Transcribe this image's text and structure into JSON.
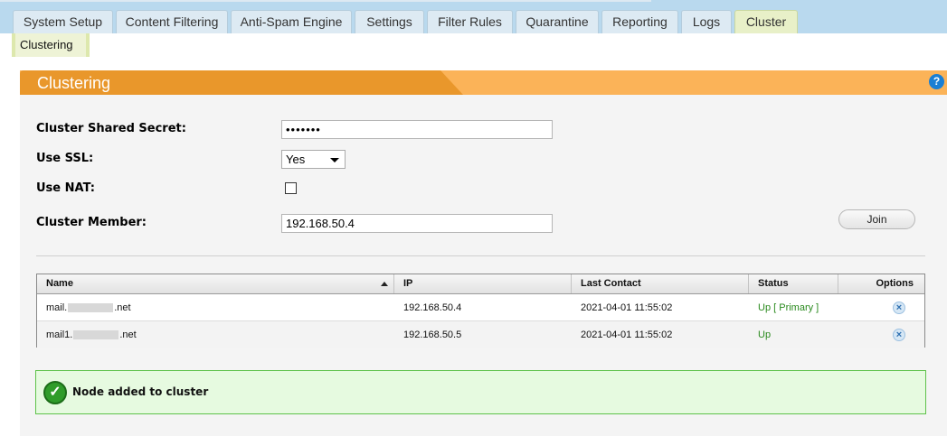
{
  "tabs": [
    {
      "label": "System Setup"
    },
    {
      "label": "Content Filtering"
    },
    {
      "label": "Anti-Spam Engine"
    },
    {
      "label": "Settings"
    },
    {
      "label": "Filter Rules"
    },
    {
      "label": "Quarantine"
    },
    {
      "label": "Reporting"
    },
    {
      "label": "Logs"
    },
    {
      "label": "Cluster",
      "active": true
    }
  ],
  "subtab": {
    "label": "Clustering"
  },
  "panel": {
    "title": "Clustering",
    "help_icon": "help-icon"
  },
  "form": {
    "secret_label": "Cluster Shared Secret:",
    "secret_value": "•••••••",
    "ssl_label": "Use SSL:",
    "ssl_value": "Yes",
    "nat_label": "Use NAT:",
    "nat_checked": false,
    "member_label": "Cluster Member:",
    "member_value": "192.168.50.4",
    "join_label": "Join"
  },
  "table": {
    "headers": [
      "Name",
      "IP",
      "Last Contact",
      "Status",
      "Options"
    ],
    "rows": [
      {
        "name_prefix": "mail.",
        "name_suffix": ".net",
        "ip": "192.168.50.4",
        "last_contact": "2021-04-01 11:55:02",
        "status": "Up [ Primary ]"
      },
      {
        "name_prefix": "mail1.",
        "name_suffix": ".net",
        "ip": "192.168.50.5",
        "last_contact": "2021-04-01 11:55:02",
        "status": "Up"
      }
    ]
  },
  "message": {
    "text": "Node added to cluster",
    "icon": "checkmark-icon"
  },
  "colors": {
    "header_orange": "#fbb358",
    "header_dark": "#e9972b",
    "success_bg": "#e6fae0",
    "status_green": "#2a8a1e"
  }
}
